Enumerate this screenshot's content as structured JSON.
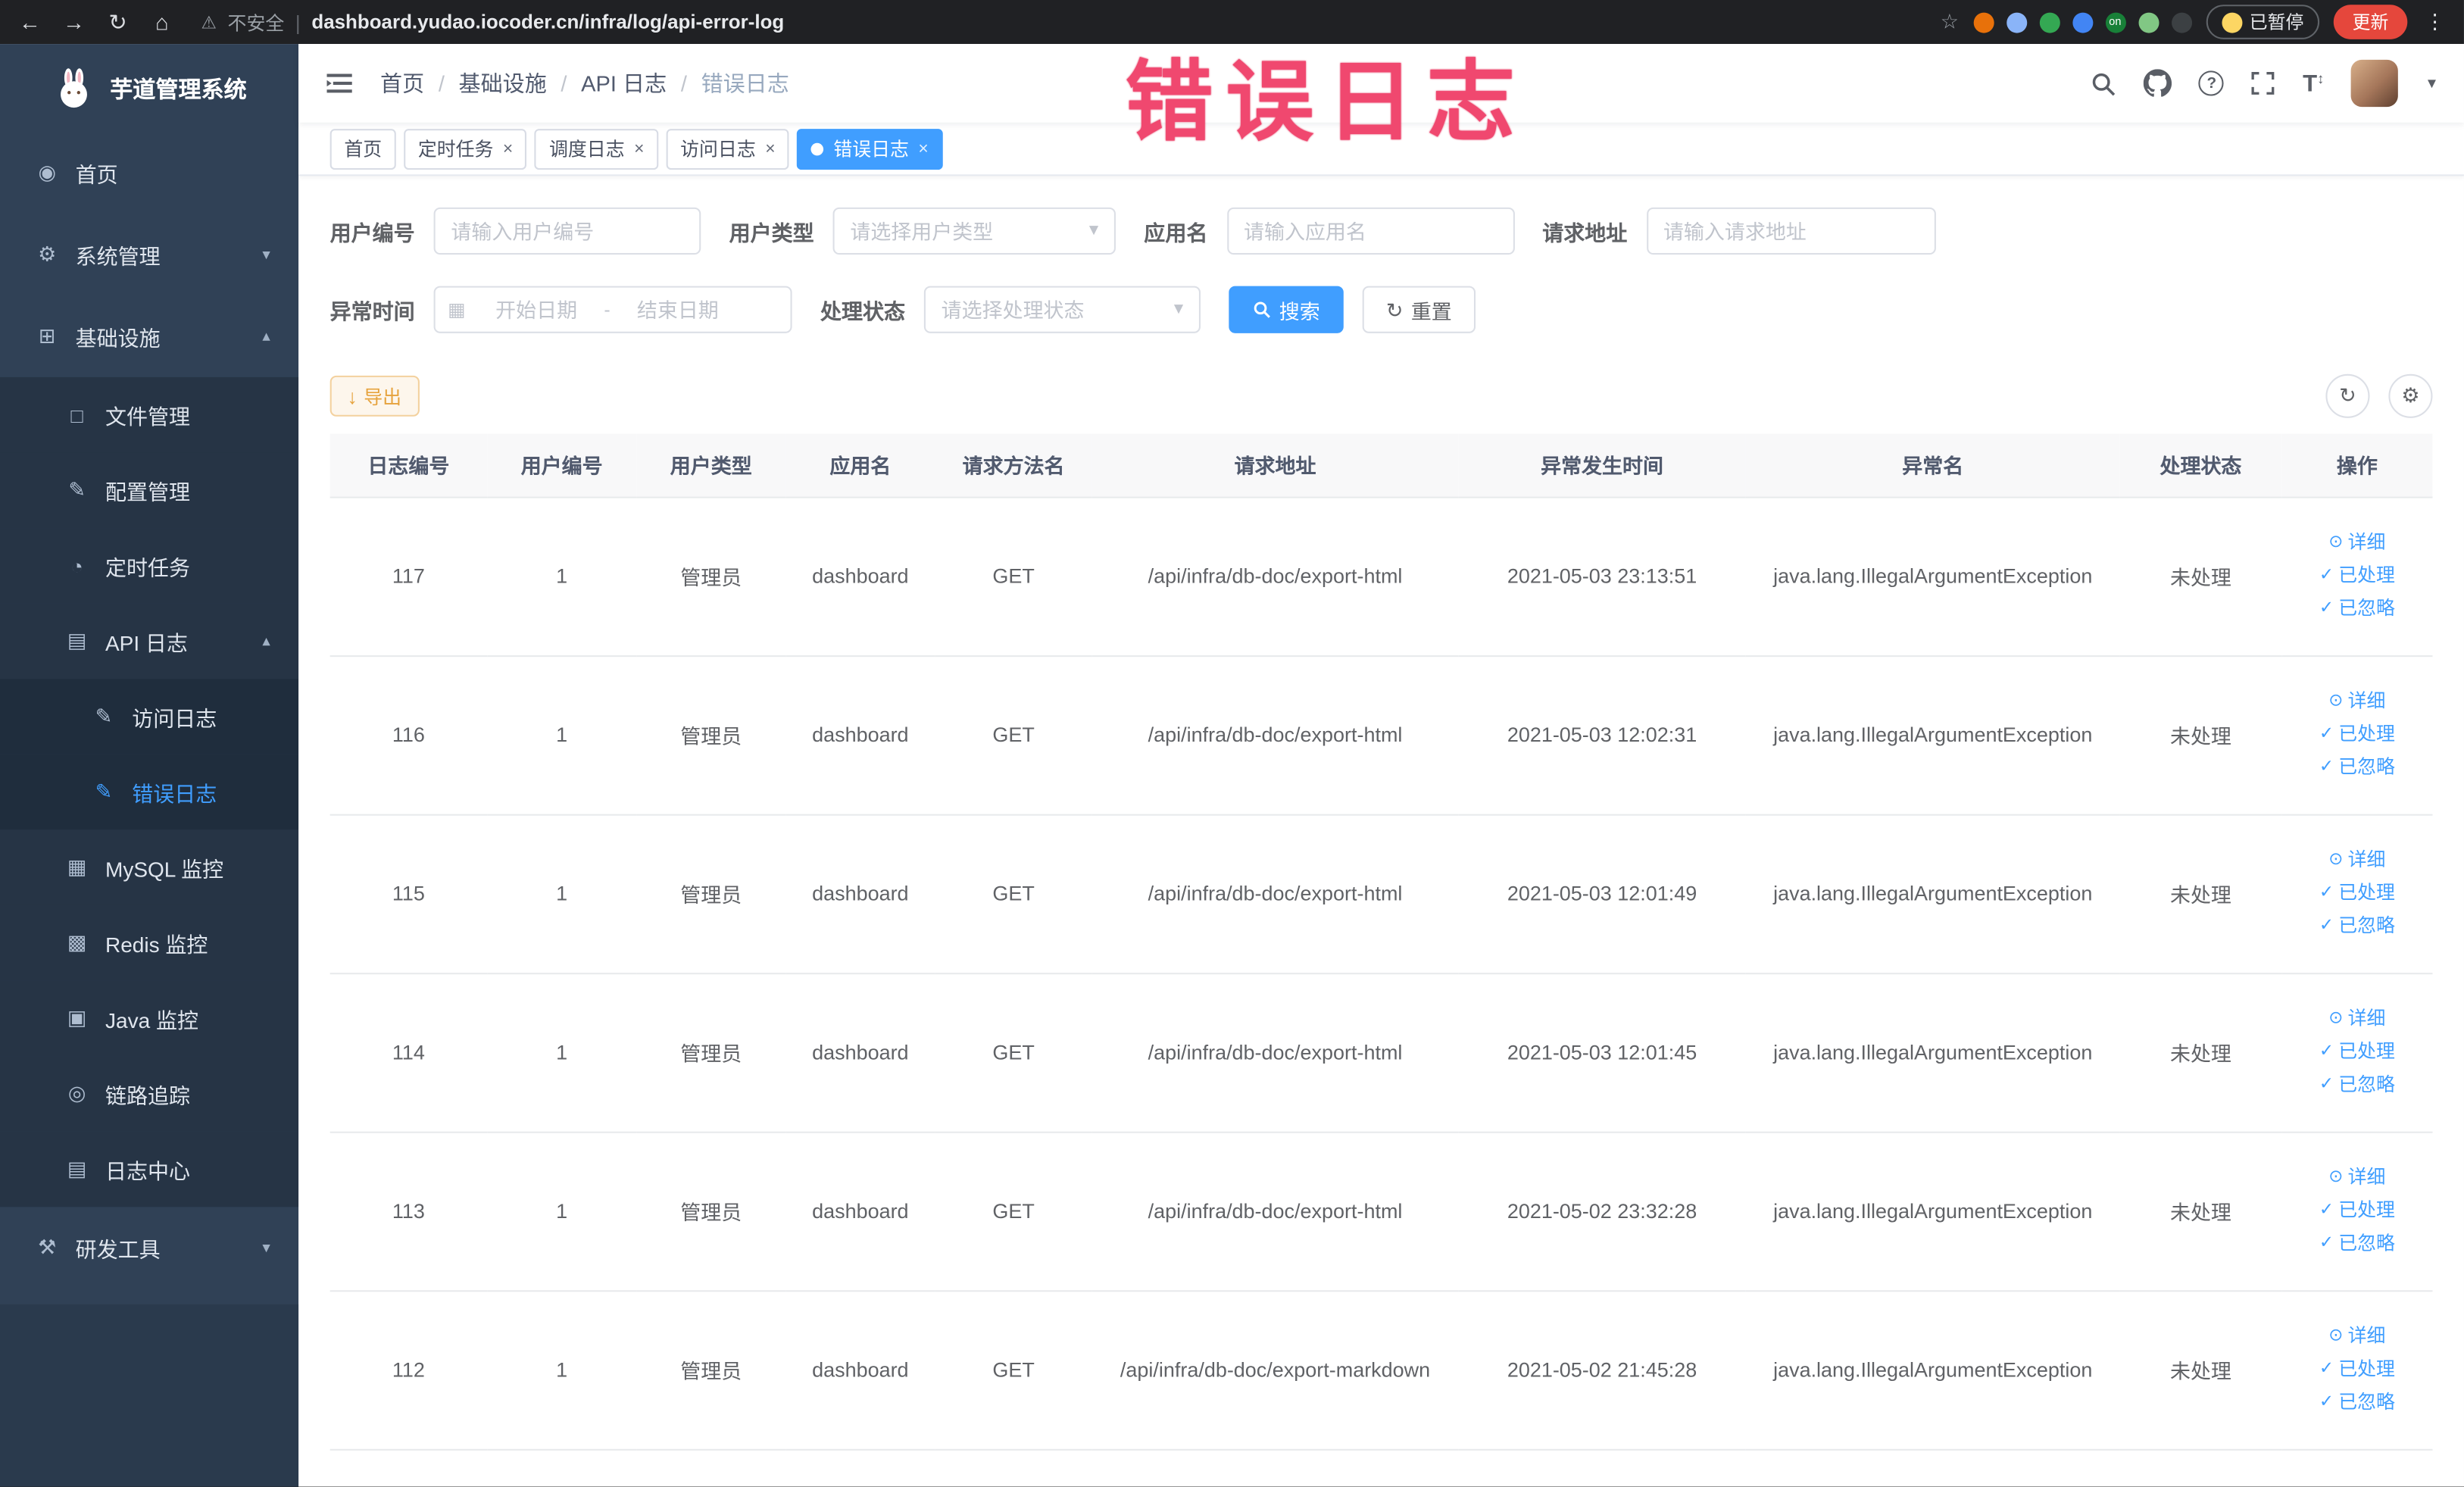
{
  "colors": {
    "accent": "#409eff",
    "warning": "#e6a23c",
    "annotation": "#f0486f",
    "sidebar_bg": "#304156"
  },
  "browser": {
    "security_label": "不安全",
    "url": "dashboard.yudao.iocoder.cn/infra/log/api-error-log",
    "paused_label": "已暂停",
    "update_label": "更新",
    "extensions": [
      {
        "name": "extension-icon-orange",
        "color": "#e8710a"
      },
      {
        "name": "extension-icon-lightblue",
        "color": "#8ab4f8"
      },
      {
        "name": "extension-icon-green-circle",
        "color": "#34a853"
      },
      {
        "name": "extension-icon-blue-grid",
        "color": "#4285f4"
      },
      {
        "name": "extension-icon-on-badge",
        "color": "#188038",
        "label": "on"
      },
      {
        "name": "extension-icon-leaf",
        "color": "#81c784"
      },
      {
        "name": "extension-icon-pin",
        "color": "#3c4043"
      }
    ]
  },
  "sidebar": {
    "logo_title": "芋道管理系统",
    "items": [
      {
        "label": "首页",
        "icon": "dashboard-icon",
        "glyph": "◉",
        "level": "0"
      },
      {
        "label": "系统管理",
        "icon": "system-icon",
        "glyph": "⚙",
        "level": "0",
        "arrow": "▾"
      },
      {
        "label": "基础设施",
        "icon": "infra-icon",
        "glyph": "⊞",
        "level": "0",
        "arrow": "▴"
      },
      {
        "label": "文件管理",
        "icon": "file-icon",
        "glyph": "□",
        "level": "1"
      },
      {
        "label": "配置管理",
        "icon": "config-icon",
        "glyph": "✎",
        "level": "1"
      },
      {
        "label": "定时任务",
        "icon": "job-icon",
        "glyph": "◔",
        "level": "1"
      },
      {
        "label": "API 日志",
        "icon": "api-log-icon",
        "glyph": "▤",
        "level": "1",
        "arrow": "▴"
      },
      {
        "label": "访问日志",
        "icon": "access-log-icon",
        "glyph": "✎",
        "level": "2"
      },
      {
        "label": "错误日志",
        "icon": "error-log-icon",
        "glyph": "✎",
        "level": "2",
        "active": "true"
      },
      {
        "label": "MySQL 监控",
        "icon": "mysql-icon",
        "glyph": "▦",
        "level": "1"
      },
      {
        "label": "Redis 监控",
        "icon": "redis-icon",
        "glyph": "▩",
        "level": "1"
      },
      {
        "label": "Java 监控",
        "icon": "java-icon",
        "glyph": "▣",
        "level": "1"
      },
      {
        "label": "链路追踪",
        "icon": "trace-icon",
        "glyph": "◎",
        "level": "1"
      },
      {
        "label": "日志中心",
        "icon": "log-center-icon",
        "glyph": "▤",
        "level": "1"
      },
      {
        "label": "研发工具",
        "icon": "dev-tools-icon",
        "glyph": "⚒",
        "level": "0",
        "arrow": "▾"
      }
    ]
  },
  "header": {
    "breadcrumb": [
      {
        "label": "首页"
      },
      {
        "label": "基础设施"
      },
      {
        "label": "API 日志"
      },
      {
        "label": "错误日志"
      }
    ]
  },
  "annotation": {
    "text": "错误日志"
  },
  "tabs": [
    {
      "label": "首页"
    },
    {
      "label": "定时任务",
      "closable": "true"
    },
    {
      "label": "调度日志",
      "closable": "true"
    },
    {
      "label": "访问日志",
      "closable": "true"
    },
    {
      "label": "错误日志",
      "closable": "true",
      "active": "true"
    }
  ],
  "filters": {
    "user_id": {
      "label": "用户编号",
      "placeholder": "请输入用户编号"
    },
    "user_type": {
      "label": "用户类型",
      "placeholder": "请选择用户类型"
    },
    "app_name": {
      "label": "应用名",
      "placeholder": "请输入应用名"
    },
    "request_url": {
      "label": "请求地址",
      "placeholder": "请输入请求地址"
    },
    "exception_time": {
      "label": "异常时间",
      "start_placeholder": "开始日期",
      "separator": "-",
      "end_placeholder": "结束日期"
    },
    "process_status": {
      "label": "处理状态",
      "placeholder": "请选择处理状态"
    },
    "search_label": "搜索",
    "reset_label": "重置"
  },
  "toolbar": {
    "export_label": "导出"
  },
  "table": {
    "columns": [
      "日志编号",
      "用户编号",
      "用户类型",
      "应用名",
      "请求方法名",
      "请求地址",
      "异常发生时间",
      "异常名",
      "处理状态",
      "操作"
    ],
    "actions": {
      "detail": "详细",
      "processed": "已处理",
      "ignored": "已忽略"
    },
    "rows": [
      {
        "id": "117",
        "user_id": "1",
        "user_type": "管理员",
        "app": "dashboard",
        "method": "GET",
        "url": "/api/infra/db-doc/export-html",
        "time": "2021-05-03 23:13:51",
        "exception": "java.lang.IllegalArgumentException",
        "status": "未处理"
      },
      {
        "id": "116",
        "user_id": "1",
        "user_type": "管理员",
        "app": "dashboard",
        "method": "GET",
        "url": "/api/infra/db-doc/export-html",
        "time": "2021-05-03 12:02:31",
        "exception": "java.lang.IllegalArgumentException",
        "status": "未处理"
      },
      {
        "id": "115",
        "user_id": "1",
        "user_type": "管理员",
        "app": "dashboard",
        "method": "GET",
        "url": "/api/infra/db-doc/export-html",
        "time": "2021-05-03 12:01:49",
        "exception": "java.lang.IllegalArgumentException",
        "status": "未处理"
      },
      {
        "id": "114",
        "user_id": "1",
        "user_type": "管理员",
        "app": "dashboard",
        "method": "GET",
        "url": "/api/infra/db-doc/export-html",
        "time": "2021-05-03 12:01:45",
        "exception": "java.lang.IllegalArgumentException",
        "status": "未处理"
      },
      {
        "id": "113",
        "user_id": "1",
        "user_type": "管理员",
        "app": "dashboard",
        "method": "GET",
        "url": "/api/infra/db-doc/export-html",
        "time": "2021-05-02 23:32:28",
        "exception": "java.lang.IllegalArgumentException",
        "status": "未处理"
      },
      {
        "id": "112",
        "user_id": "1",
        "user_type": "管理员",
        "app": "dashboard",
        "method": "GET",
        "url": "/api/infra/db-doc/export-markdown",
        "time": "2021-05-02 21:45:28",
        "exception": "java.lang.IllegalArgumentException",
        "status": "未处理"
      }
    ]
  }
}
